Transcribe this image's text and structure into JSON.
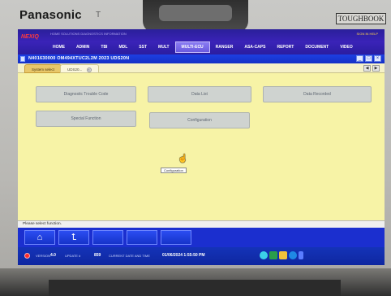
{
  "device": {
    "brand": "Panasonic",
    "brand_tail": "T",
    "model_badge": "TOUGHBOOK"
  },
  "app": {
    "logo": "NEXIQ",
    "utility_left": "HOME  SOLUTIONS  DIAGNOSTICS  INFORMATION",
    "utility_right": "SIGN IN   HELP",
    "menu": [
      "HOME",
      "ADMIN",
      "TBI",
      "MDL",
      "SST",
      "MULT",
      "MULTI-ECU",
      "RANGER",
      "ASA-CAPS",
      "REPORT",
      "DOCUMENT",
      "VIDEO"
    ],
    "menu_active_index": 6,
    "window_title": "N401630000  OM494XTUC2L2M 2023  UDS20N",
    "window_buttons": [
      "_",
      "□",
      "×"
    ],
    "tabs": [
      {
        "label": "System select"
      },
      {
        "label": "UDS20...",
        "close": "×"
      }
    ],
    "nav_arrows": [
      "◀",
      "▶"
    ],
    "functions": [
      {
        "label": "Diagnostic Trouble Code"
      },
      {
        "label": "Data List"
      },
      {
        "label": "Data Recorded"
      },
      {
        "label": "Special Function"
      },
      {
        "label": "Configuration"
      }
    ],
    "tooltip": "Configuration",
    "message": "Please select function.",
    "toolbar": [
      {
        "icon": "home-icon",
        "glyph": "⌂"
      },
      {
        "icon": "back-icon",
        "glyph": "⮤"
      },
      {
        "icon": "blank",
        "glyph": ""
      },
      {
        "icon": "blank",
        "glyph": ""
      },
      {
        "icon": "blank",
        "glyph": ""
      }
    ],
    "status": {
      "version_label": "VERSION",
      "version_value": "4.0",
      "update_label": "UPDATE #",
      "update_value": "859",
      "datetime_label": "CURRENT DATE AND TIME",
      "datetime_value": "01/06/2024 1:55:50 PM"
    },
    "colors": {
      "accent": "#1b2fcf",
      "content_bg": "#f7f3a6",
      "button_bg": "#cfd3d0"
    }
  }
}
